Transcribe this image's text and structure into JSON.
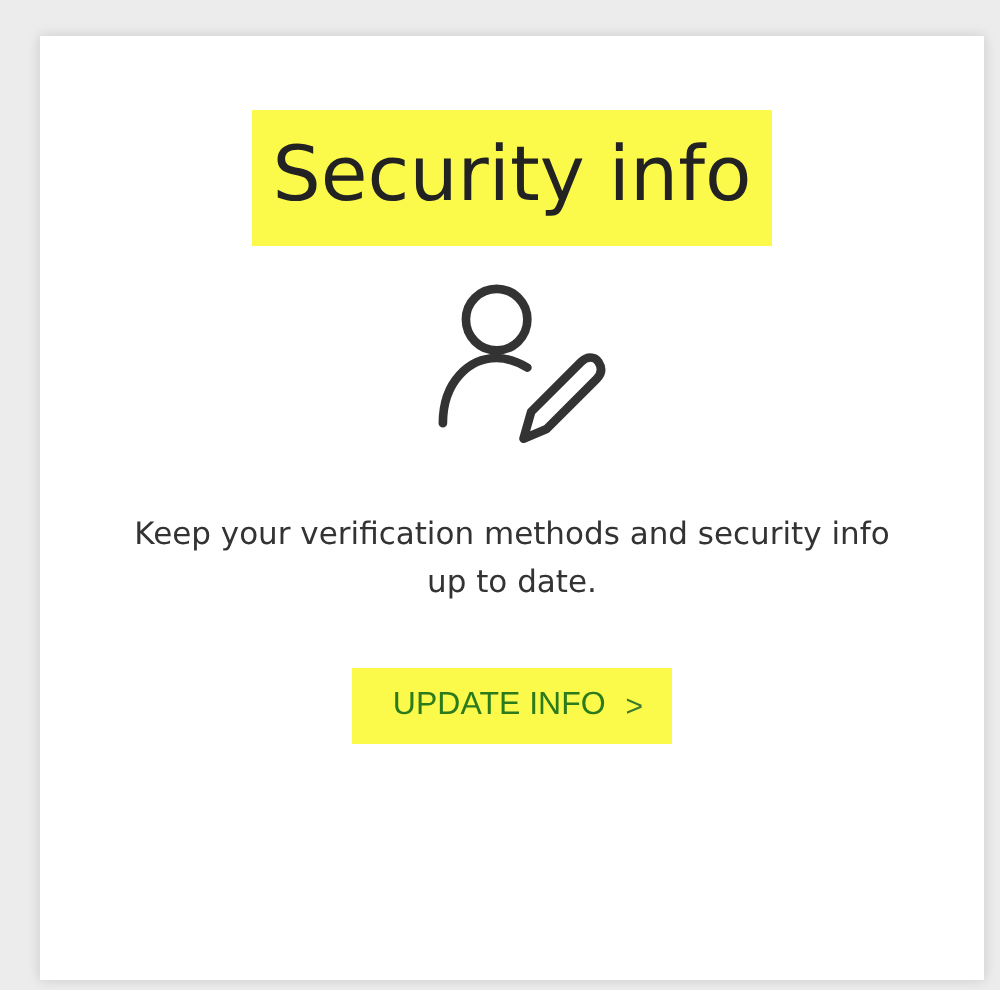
{
  "card": {
    "title": {
      "text": "Security info",
      "highlighted": true
    },
    "description": "Keep your verification methods and security info up to date.",
    "link": {
      "label": "UPDATE INFO",
      "chevron": ">",
      "highlighted": true
    }
  }
}
